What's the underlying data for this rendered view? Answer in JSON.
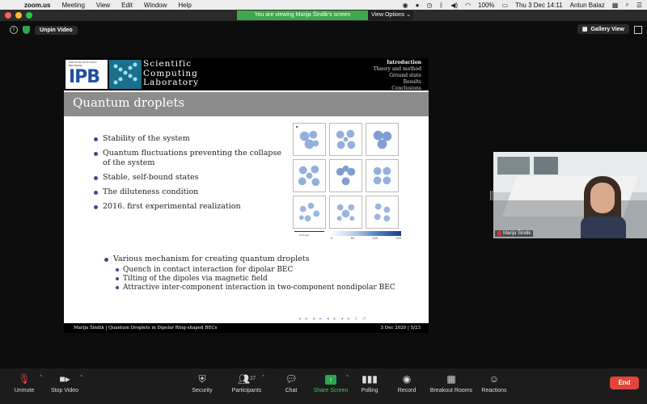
{
  "menubar": {
    "app": "zoom.us",
    "menus": [
      "Meeting",
      "View",
      "Edit",
      "Window",
      "Help"
    ],
    "battery": "100%",
    "clock": "Thu 3 Dec  14:11",
    "user": "Antun Balaz"
  },
  "banner": {
    "share_text": "You are viewing Marija Šindik's screen",
    "view_options": "View Options"
  },
  "topbar": {
    "unpin_label": "Unpin Video",
    "gallery_label": "Gallery View"
  },
  "slide": {
    "logo_ipb_small": "INSTITUTE OF PHYSICS BELGRADE",
    "logo_ipb_big": "IPB",
    "lab_lines": [
      "Scientific",
      "Computing",
      "Laboratory"
    ],
    "nav": [
      "Introduction",
      "Theory and method",
      "Ground state",
      "Results",
      "Conclusions"
    ],
    "title": "Quantum droplets",
    "bullets": [
      "Stability of the system",
      "Quantum fluctuations preventing the collapse of the system",
      "Stable, self-bound states",
      "The diluteness condition",
      "2016. first experimental realization"
    ],
    "bullet2": "Various mechanism for creating quantum droplets",
    "sub_bullets": [
      "Quench in contact interaction for dipolar BEC",
      "Tilting of the dipoles via magnetic field",
      "Attractive inter-component interaction in two-component nondipolar BEC"
    ],
    "figure": {
      "panel_label": "a",
      "scale_label": "10.5 μm",
      "colorbar_ticks": [
        "0",
        "50",
        "100",
        "150"
      ]
    },
    "beamer_nav": "◂ ▸ ◂ ▸ ◂ ▸ ◂ ▸ ≡ ↺",
    "footer_left": "Marija Šindik  |  Quantum Droplets in Dipolar Ring-shaped BECs",
    "footer_right": "3 Dec 2020  |  5/23"
  },
  "video": {
    "participant": "Marija Šindik"
  },
  "toolbar": {
    "unmute": "Unmute",
    "stop_video": "Stop Video",
    "security": "Security",
    "participants": "Participants",
    "participants_count": "27",
    "chat": "Chat",
    "share_screen": "Share Screen",
    "polling": "Polling",
    "record": "Record",
    "breakout": "Breakout Rooms",
    "reactions": "Reactions",
    "end": "End"
  },
  "colors": {
    "share_green": "#3fa84c",
    "end_red": "#e0443b",
    "bullet_blue": "#3a4a8f"
  }
}
